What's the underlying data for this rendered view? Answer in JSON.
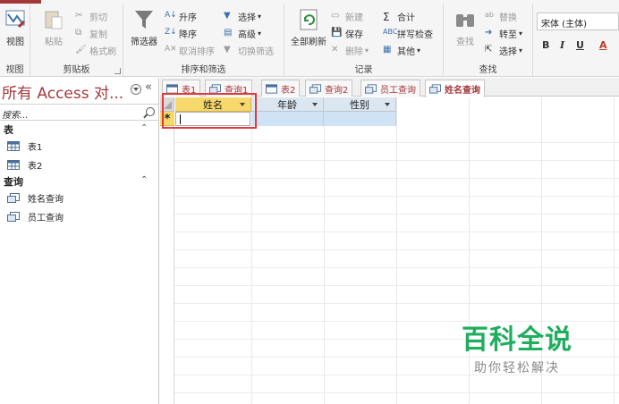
{
  "ribbon": {
    "groups": {
      "views": {
        "label": "视图",
        "button": "视图"
      },
      "clipboard": {
        "label": "剪贴板",
        "paste": "粘贴",
        "cut": "剪切",
        "copy": "复制",
        "format_painter": "格式刷"
      },
      "sort_filter": {
        "label": "排序和筛选",
        "filter": "筛选器",
        "ascending": "升序",
        "descending": "降序",
        "remove_sort": "取消排序",
        "selection": "选择",
        "advanced": "高级",
        "toggle_filter": "切换筛选"
      },
      "records": {
        "label": "记录",
        "refresh_all": "全部刷新",
        "new": "新建",
        "save": "保存",
        "delete": "删除",
        "totals": "合计",
        "spelling": "拼写检查",
        "more": "其他"
      },
      "find": {
        "label": "查找",
        "find": "查找",
        "replace": "替换",
        "goto": "转至",
        "select": "选择"
      },
      "text_format": {
        "font": "宋体 (主体)",
        "bold": "B",
        "italic": "I",
        "underline": "U",
        "font_color": "A"
      }
    }
  },
  "nav": {
    "title": "所有 Access 对...",
    "collapse": "«",
    "search_placeholder": "搜索...",
    "sections": [
      {
        "label": "表",
        "items": [
          "表1",
          "表2"
        ]
      },
      {
        "label": "查询",
        "items": [
          "姓名查询",
          "员工查询"
        ]
      }
    ]
  },
  "tabs": [
    {
      "label": "表1",
      "type": "table"
    },
    {
      "label": "查询1",
      "type": "query"
    },
    {
      "label": "表2",
      "type": "table"
    },
    {
      "label": "查询2",
      "type": "query"
    },
    {
      "label": "员工查询",
      "type": "query"
    },
    {
      "label": "姓名查询",
      "type": "query",
      "active": true
    }
  ],
  "datasheet": {
    "columns": [
      "姓名",
      "年龄",
      "性别"
    ],
    "new_row_marker": "*"
  },
  "watermark": {
    "main": "百科全说",
    "sub": "助你轻松解决"
  },
  "colors": {
    "accent": "#a4373a",
    "highlight": "#e0393e",
    "selected_header": "#f6d86b",
    "watermark": "#1fae5d"
  }
}
